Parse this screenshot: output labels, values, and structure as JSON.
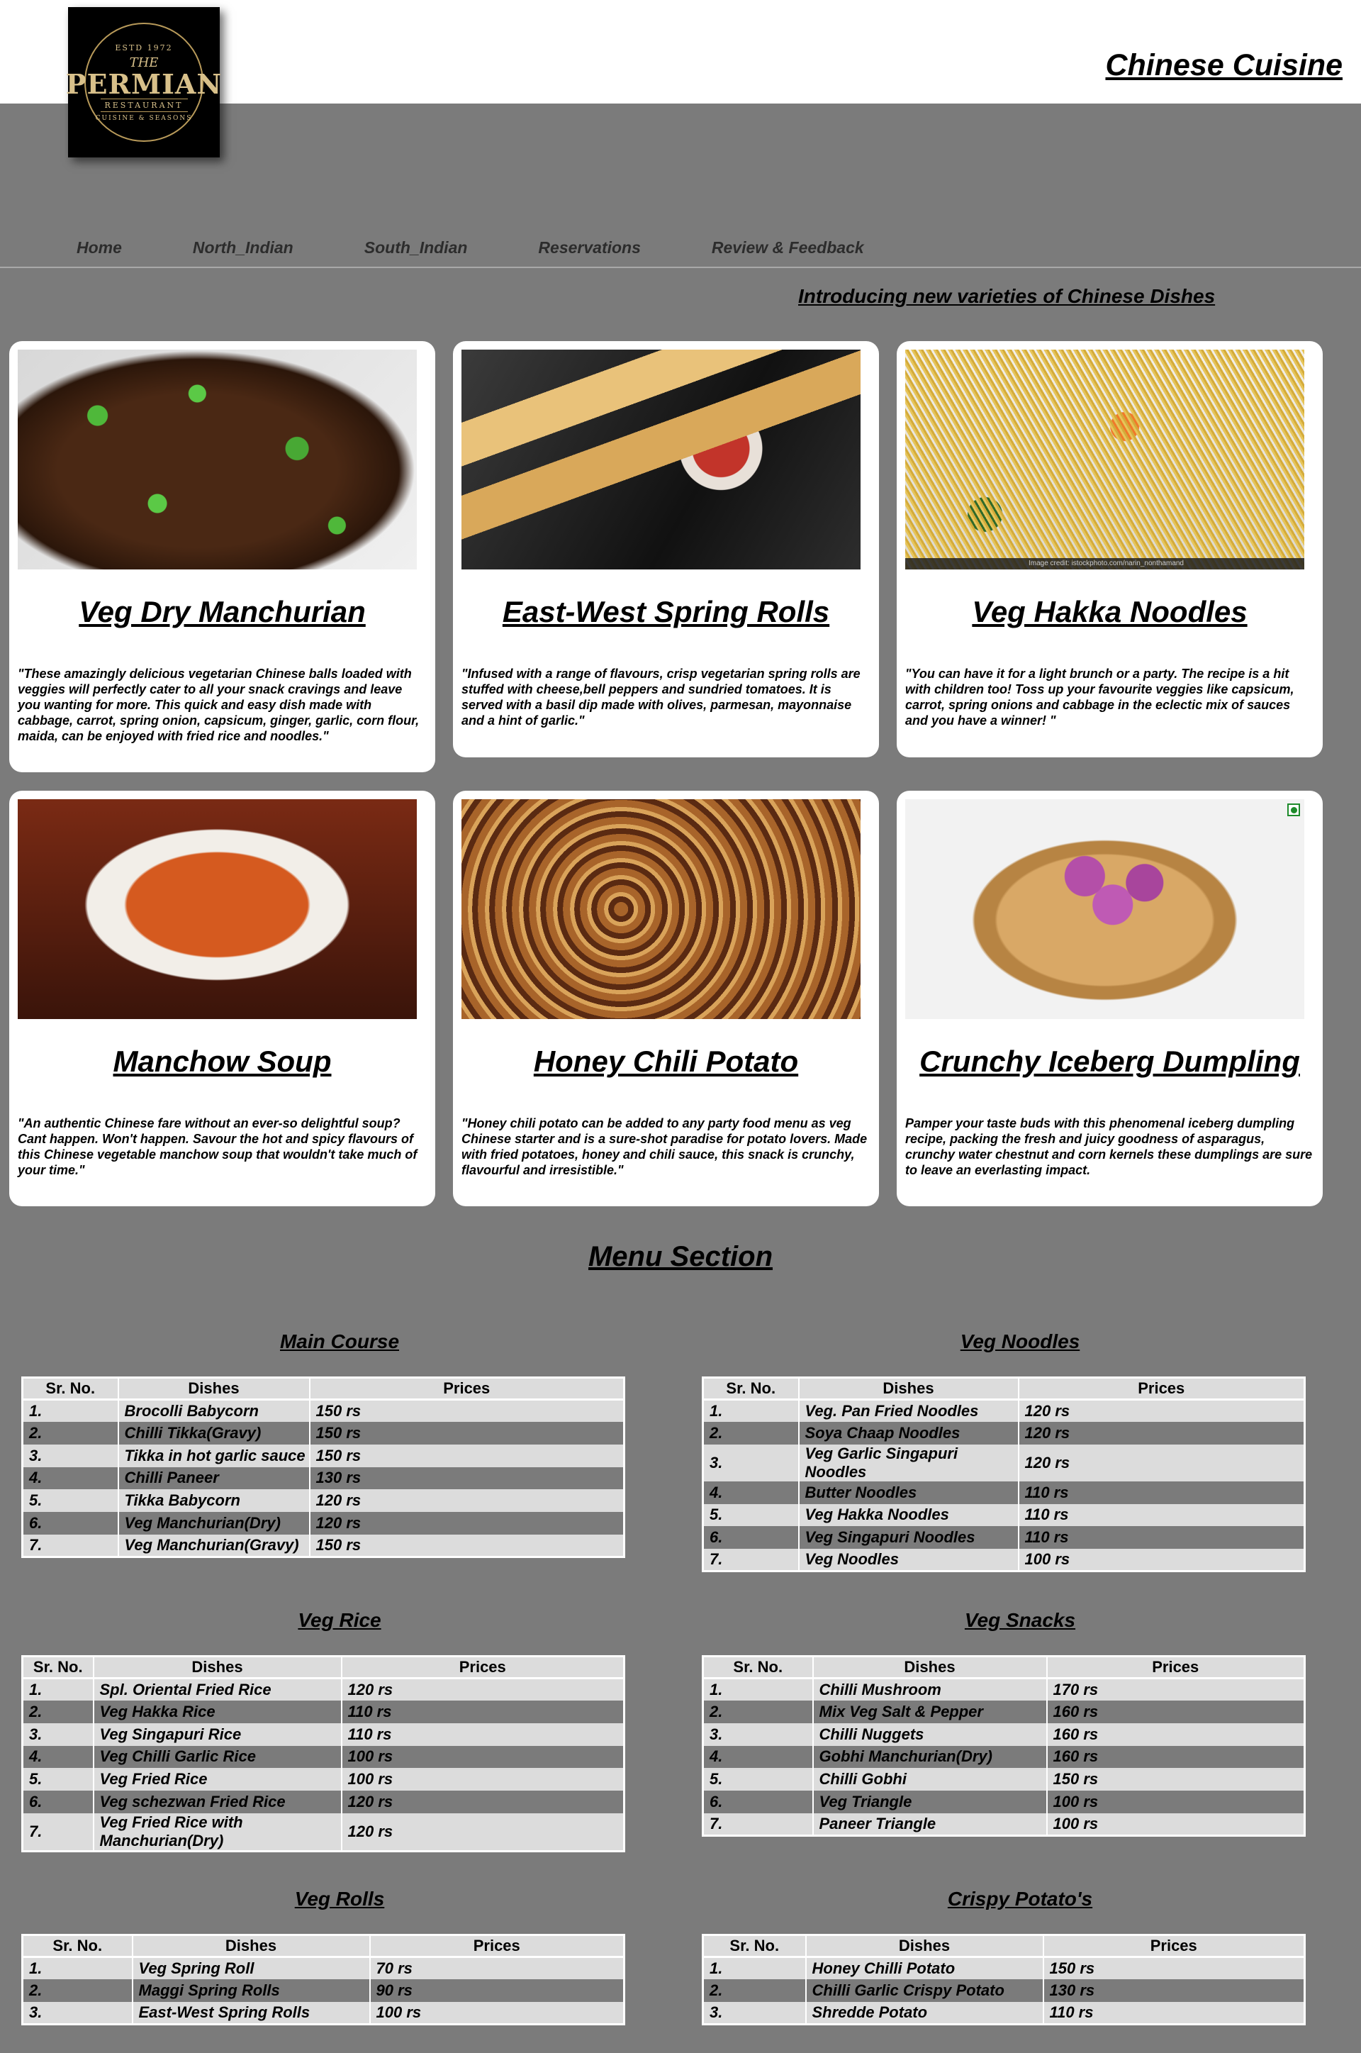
{
  "header": {
    "logo": {
      "est": "ESTD 1972",
      "the": "THE",
      "name": "PERMIAN",
      "sub": "RESTAURANT",
      "tag": "CUISINE & SEASONS"
    },
    "title": "Chinese  Cuisine"
  },
  "nav": [
    "Home",
    "North_Indian",
    "South_Indian",
    "Reservations",
    "Review & Feedback"
  ],
  "intro": "Introducing new varieties of Chinese Dishes",
  "cards": [
    {
      "title": "Veg Dry Manchurian",
      "desc": "\"These amazingly delicious vegetarian Chinese balls loaded with veggies will perfectly cater to all your snack cravings and leave you wanting for more. This quick and easy dish made with cabbage, carrot, spring onion, capsicum, ginger, garlic, corn flour, maida, can be enjoyed with fried rice and noodles.\""
    },
    {
      "title": "East-West Spring Rolls",
      "desc": "\"Infused with a range of flavours, crisp vegetarian spring rolls are stuffed with cheese,bell peppers and sundried tomatoes. It is served with a basil dip made with olives, parmesan, mayonnaise and a hint of garlic.\""
    },
    {
      "title": "Veg Hakka Noodles",
      "desc": "\"You can have it for a light brunch or a party. The recipe is a hit with children too! Toss up your favourite veggies like capsicum, carrot, spring onions and cabbage in the eclectic mix of sauces and you have a winner! \"",
      "credit": "Image credit: istockphoto.com/narin_nonthamand"
    },
    {
      "title": "Manchow Soup",
      "desc": "\"An authentic Chinese fare without an ever-so delightful soup? Cant happen. Won't happen. Savour the hot and spicy flavours of this Chinese vegetable manchow soup that wouldn't take much of your time.\""
    },
    {
      "title": "Honey Chili Potato",
      "desc": "\"Honey chili potato can be added to any party food menu as veg Chinese starter and is a sure-shot paradise for potato lovers. Made with fried potatoes, honey and chili sauce, this snack is crunchy, flavourful and irresistible.\""
    },
    {
      "title": "Crunchy Iceberg Dumpling",
      "desc": "Pamper your taste buds with this phenomenal iceberg dumpling recipe, packing the fresh and juicy goodness of asparagus, crunchy water chestnut and corn kernels these dumplings are sure to leave an everlasting impact."
    }
  ],
  "menu_title": "Menu Section",
  "headers": {
    "sr": "Sr. No.",
    "dish": "Dishes",
    "price": "Prices"
  },
  "sections": [
    {
      "title": "Main Course",
      "rows": [
        [
          "1.",
          "Brocolli Babycorn",
          "150 rs"
        ],
        [
          "2.",
          "Chilli Tikka(Gravy)",
          "150 rs"
        ],
        [
          "3.",
          "Tikka in hot garlic sauce",
          "150 rs"
        ],
        [
          "4.",
          "Chilli Paneer",
          "130 rs"
        ],
        [
          "5.",
          "Tikka Babycorn",
          "120 rs"
        ],
        [
          "6.",
          "Veg Manchurian(Dry)",
          "120 rs"
        ],
        [
          "7.",
          "Veg Manchurian(Gravy)",
          "150 rs"
        ]
      ]
    },
    {
      "title": "Veg Noodles",
      "rows": [
        [
          "1.",
          "Veg. Pan Fried Noodles",
          "120 rs"
        ],
        [
          "2.",
          "Soya Chaap Noodles",
          "120 rs"
        ],
        [
          "3.",
          "Veg Garlic Singapuri Noodles",
          "120 rs"
        ],
        [
          "4.",
          "Butter Noodles",
          "110 rs"
        ],
        [
          "5.",
          "Veg Hakka Noodles",
          "110 rs"
        ],
        [
          "6.",
          "Veg Singapuri Noodles",
          "110 rs"
        ],
        [
          "7.",
          "Veg Noodles",
          "100 rs"
        ]
      ]
    },
    {
      "title": "Veg Rice",
      "rows": [
        [
          "1.",
          "Spl. Oriental Fried Rice",
          "120 rs"
        ],
        [
          "2.",
          "Veg Hakka Rice",
          "110 rs"
        ],
        [
          "3.",
          "Veg Singapuri Rice",
          "110 rs"
        ],
        [
          "4.",
          "Veg Chilli Garlic Rice",
          "100 rs"
        ],
        [
          "5.",
          "Veg Fried Rice",
          "100 rs"
        ],
        [
          "6.",
          "Veg schezwan Fried Rice",
          "120 rs"
        ],
        [
          "7.",
          "Veg Fried Rice with Manchurian(Dry)",
          "120 rs"
        ]
      ]
    },
    {
      "title": "Veg Snacks",
      "rows": [
        [
          "1.",
          "Chilli Mushroom",
          "170 rs"
        ],
        [
          "2.",
          "Mix Veg Salt & Pepper",
          "160 rs"
        ],
        [
          "3.",
          "Chilli Nuggets",
          "160 rs"
        ],
        [
          "4.",
          "Gobhi Manchurian(Dry)",
          "160 rs"
        ],
        [
          "5.",
          "Chilli Gobhi",
          "150 rs"
        ],
        [
          "6.",
          "Veg Triangle",
          "100 rs"
        ],
        [
          "7.",
          "Paneer Triangle",
          "100 rs"
        ]
      ]
    },
    {
      "title": "Veg Rolls",
      "rows": [
        [
          "1.",
          "Veg Spring Roll",
          "70 rs"
        ],
        [
          "2.",
          "Maggi Spring Rolls",
          "90 rs"
        ],
        [
          "3.",
          "East-West Spring Rolls",
          "100 rs"
        ]
      ]
    },
    {
      "title": "Crispy Potato's",
      "rows": [
        [
          "1.",
          "Honey Chilli Potato",
          "150 rs"
        ],
        [
          "2.",
          "Chilli Garlic Crispy Potato",
          "130 rs"
        ],
        [
          "3.",
          "Shredde Potato",
          "110 rs"
        ]
      ]
    }
  ]
}
